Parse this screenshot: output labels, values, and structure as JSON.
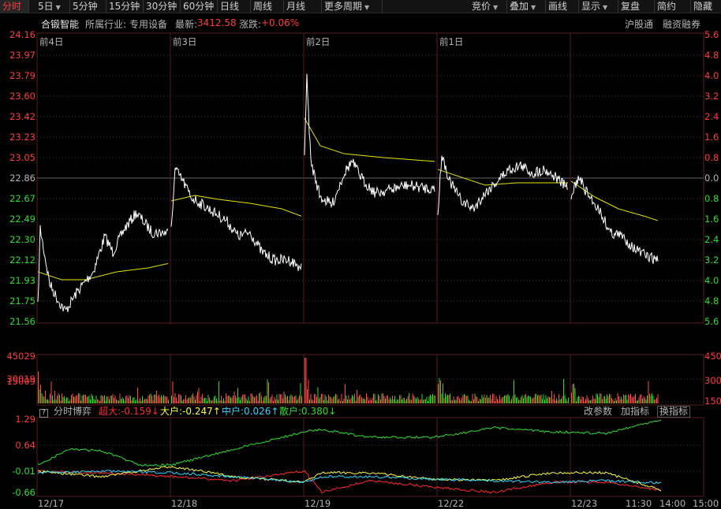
{
  "toolbar": {
    "left": [
      {
        "label": "分时",
        "active": true,
        "dropdown": false
      },
      {
        "label": "5日",
        "active": false,
        "dropdown": true
      },
      {
        "label": "5分钟",
        "active": false,
        "dropdown": false
      },
      {
        "label": "15分钟",
        "active": false,
        "dropdown": false
      },
      {
        "label": "30分钟",
        "active": false,
        "dropdown": false
      },
      {
        "label": "60分钟",
        "active": false,
        "dropdown": false
      },
      {
        "label": "日线",
        "active": false,
        "dropdown": false
      },
      {
        "label": "周线",
        "active": false,
        "dropdown": false
      },
      {
        "label": "月线",
        "active": false,
        "dropdown": false
      },
      {
        "label": "更多周期",
        "active": false,
        "dropdown": true
      }
    ],
    "right": [
      {
        "label": "竞价",
        "dropdown": true
      },
      {
        "label": "叠加",
        "dropdown": true
      },
      {
        "label": "画线",
        "dropdown": false
      },
      {
        "label": "显示",
        "dropdown": true
      },
      {
        "label": "复盘",
        "dropdown": false
      },
      {
        "label": "简约",
        "dropdown": false
      },
      {
        "label": "隐藏",
        "dropdown": false
      }
    ]
  },
  "info": {
    "stock_name": "合锻智能",
    "industry_label": "所属行业:",
    "industry_value": "专用设备",
    "latest_label": "最新:",
    "latest_value": "3412.58",
    "change_label": "涨跌:",
    "change_value": "+0.06%",
    "link_1": "沪股通",
    "link_2": "融资融券"
  },
  "price_axis": {
    "left": [
      "24.16",
      "23.97",
      "23.79",
      "23.60",
      "23.42",
      "23.23",
      "23.05",
      "22.86",
      "22.67",
      "22.49",
      "22.30",
      "22.12",
      "21.93",
      "21.75",
      "21.56"
    ],
    "right": [
      "5.6",
      "4.8",
      "4.0",
      "3.2",
      "2.4",
      "1.6",
      "0.8",
      "0.0",
      "0.8",
      "1.6",
      "2.4",
      "3.2",
      "4.0",
      "4.8",
      "5.6"
    ],
    "right_colors": [
      "#ff3b3b",
      "#ff3b3b",
      "#ff3b3b",
      "#ff3b3b",
      "#ff3b3b",
      "#ff3b3b",
      "#ff3b3b",
      "#b4b4b4",
      "#2adf2a",
      "#2adf2a",
      "#2adf2a",
      "#2adf2a",
      "#2adf2a",
      "#2adf2a",
      "#2adf2a"
    ],
    "ref_price": 22.86,
    "min": 21.56,
    "max": 24.16
  },
  "day_labels": [
    "前4日",
    "前3日",
    "前2日",
    "前1日"
  ],
  "volume_axis": [
    "45029",
    "30019",
    "15009"
  ],
  "volume_max": 45029,
  "indicator": {
    "help_glyph": "?",
    "name": "分时博弈",
    "series": [
      {
        "label": "超大:-0.159",
        "arrow": "↓",
        "color": "#ff2a2a"
      },
      {
        "label": "大户:-0.247",
        "arrow": "↑",
        "color": "#ffff3c"
      },
      {
        "label": "中户:0.026",
        "arrow": "↑",
        "color": "#2ad6ff"
      },
      {
        "label": "散户:0.380",
        "arrow": "↓",
        "color": "#2adf2a"
      }
    ],
    "buttons": [
      "改参数",
      "加指标",
      "换指标"
    ],
    "axis": [
      "1.29",
      "0.64",
      "-0.01",
      "-0.66"
    ],
    "min": -0.66,
    "max": 1.29
  },
  "time_axis": [
    "12/17",
    "12/18",
    "12/19",
    "12/22",
    "12/23",
    "11:30",
    "14:00",
    "15:00"
  ],
  "colors": {
    "price_line": "#ffffff",
    "avg_line": "#e6e600",
    "up_bar": "#ff4d4d",
    "down_bar": "#2adf2a",
    "grid": "#5a1a1a",
    "grid_dotted": "#3b3b3b"
  }
}
